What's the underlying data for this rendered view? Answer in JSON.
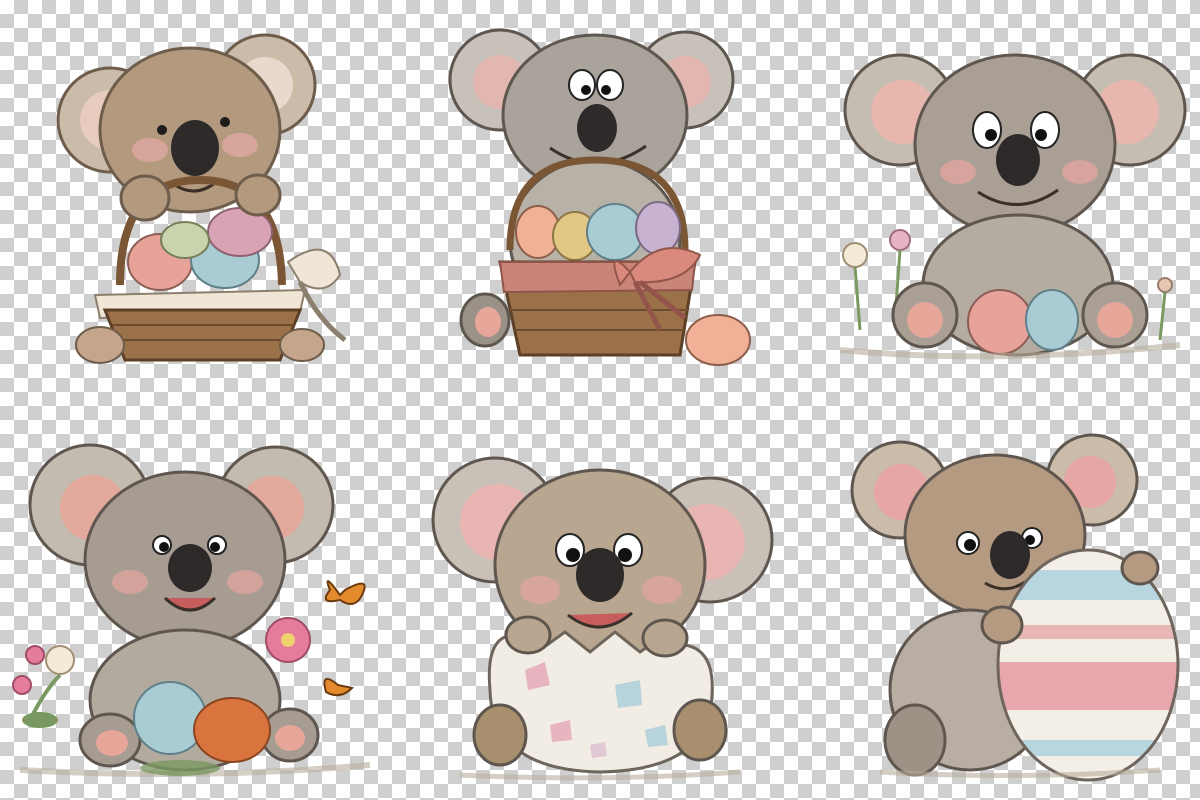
{
  "palette": {
    "fur_brown": "#a38b72",
    "fur_gray": "#a9a29a",
    "fur_light": "#e9e1d6",
    "ear_pink": "#e6aaa6",
    "nose": "#2d2a29",
    "basket": "#9b7149",
    "basket_dark": "#6d4b2d",
    "ribbon_cream": "#efe6d6",
    "ribbon_coral": "#d98a7c",
    "egg_pink": "#e7a39a",
    "egg_blue": "#a9cbd3",
    "egg_yellow": "#e2c884",
    "egg_purple": "#c7b3d1",
    "egg_green": "#c9d3ad",
    "egg_orange": "#d9743f",
    "egg_peach": "#f0b196",
    "flower_pink": "#e47d9b",
    "flower_cream": "#f4ead8",
    "leaf": "#7a9960",
    "butterfly": "#e38b2c"
  },
  "illustrations": [
    {
      "subject": "koala-with-basket-of-eggs-and-cream-bow",
      "icon": "koala-basket-icon"
    },
    {
      "subject": "koala-with-basket-and-coral-bow",
      "icon": "koala-basket-icon"
    },
    {
      "subject": "koala-sitting-with-eggs-and-flowers",
      "icon": "koala-eggs-icon"
    },
    {
      "subject": "koala-with-eggs-flowers-butterflies",
      "icon": "koala-butterfly-icon"
    },
    {
      "subject": "koala-hatching-from-egg",
      "icon": "koala-egg-shell-icon"
    },
    {
      "subject": "koala-hugging-striped-egg",
      "icon": "koala-striped-egg-icon"
    }
  ]
}
